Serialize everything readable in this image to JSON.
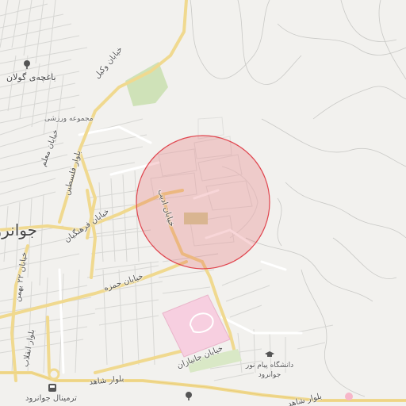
{
  "map": {
    "selection_circle": {
      "color": "#e0464f",
      "fill_opacity": 0.22
    },
    "city": {
      "name": "جوانرود"
    },
    "streets": {
      "khiaban_kol": "خیابان وکیل",
      "khiaban_moalem": "خیابان معلم",
      "khiaban_felestin": "بلوار فلسطین",
      "khiaban_farhangian": "خیابان فرهنگیان",
      "khiaban_22_bahman": "خیابان ۲۲ بهمن",
      "khiaban_hamzeh": "خیابان حمزه",
      "khiaban_adib": "خیابان ادیب",
      "blvd_enghelab": "بلوار انقلاب",
      "khiaban_janbazan": "خیابان جانبازان",
      "blvd_shahed_w": "بلوار شاهد",
      "blvd_shahed_e": "بلوار شاهد"
    },
    "pois": {
      "garden": "باغچه‌ی گولان",
      "sports": "مجموعه ورزشی",
      "university": "دانشگاه پیام نور جوانرود",
      "terminal": "ترمینال جوانرود"
    },
    "icons": {
      "garden": "tree-icon",
      "university": "graduation-cap-icon",
      "terminal": "bus-icon",
      "park_bottom": "tree-icon"
    }
  }
}
